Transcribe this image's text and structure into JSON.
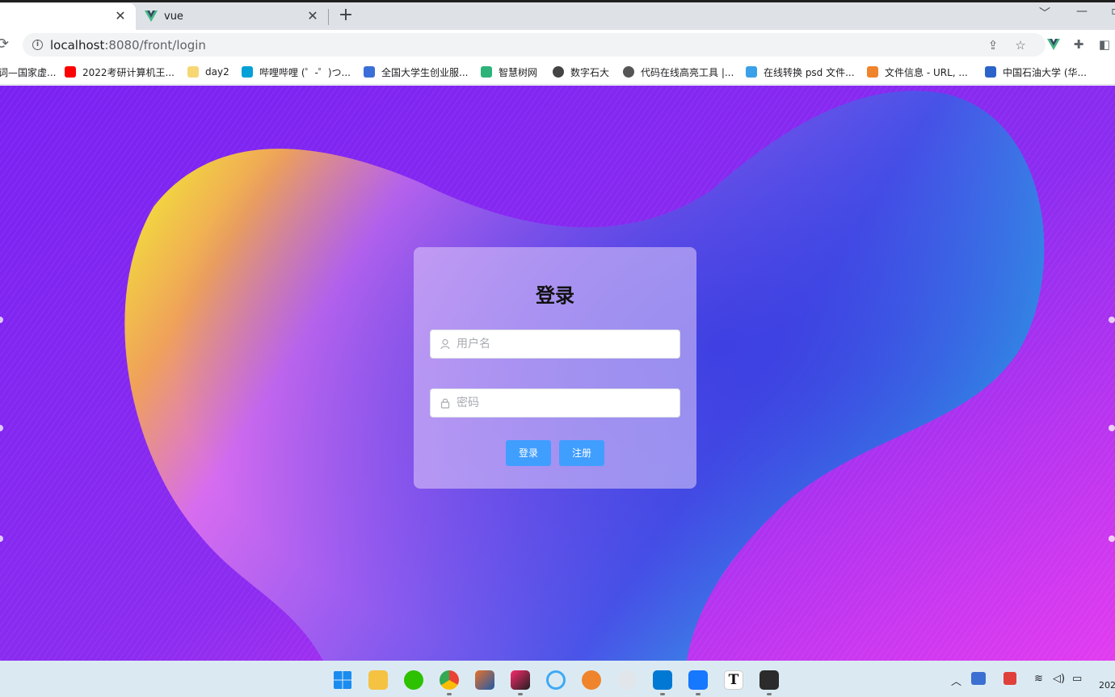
{
  "browser": {
    "tabs": [
      {
        "title": "",
        "active": true
      },
      {
        "title": "vue",
        "active": false
      }
    ],
    "url_host": "localhost",
    "url_rest": ":8080/front/login",
    "bookmarks": [
      {
        "label": "词—国家虚...",
        "color": "#888888"
      },
      {
        "label": "2022考研计算机王...",
        "color": "#ff0000"
      },
      {
        "label": "day2",
        "color": "#f7d774"
      },
      {
        "label": "哔哩哔哩 (゜-゜)つ...",
        "color": "#00a1d6"
      },
      {
        "label": "全国大学生创业服...",
        "color": "#3a6fd8"
      },
      {
        "label": "智慧树网",
        "color": "#2db37a"
      },
      {
        "label": "数字石大",
        "color": "#444444"
      },
      {
        "label": "代码在线高亮工具 |...",
        "color": "#555555"
      },
      {
        "label": "在线转换 psd 文件...",
        "color": "#3aa0e8"
      },
      {
        "label": "文件信息 - URL, ...",
        "color": "#f0842c"
      },
      {
        "label": "中国石油大学 (华...",
        "color": "#2b63c9"
      }
    ]
  },
  "login": {
    "title": "登录",
    "username_placeholder": "用户名",
    "password_placeholder": "密码",
    "login_button": "登录",
    "register_button": "注册"
  },
  "taskbar": {
    "clock_partial": "202"
  },
  "colors": {
    "background": "#7b2df0",
    "primary_button": "#409eff",
    "taskbar": "#dbeaf2"
  }
}
